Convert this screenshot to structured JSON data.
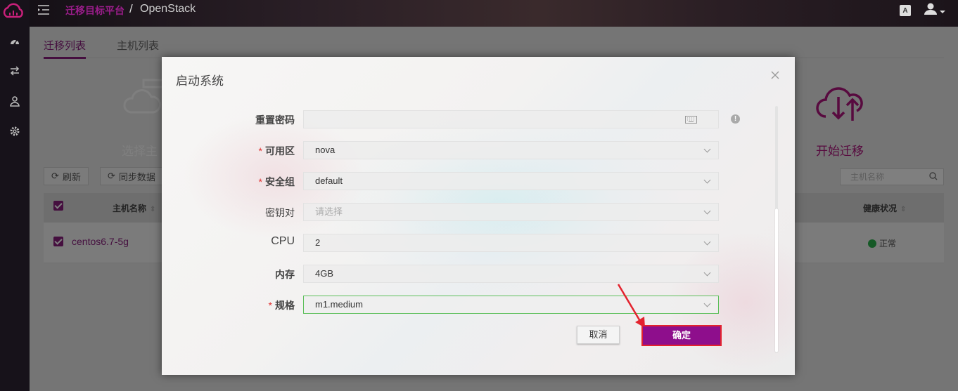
{
  "header": {
    "breadcrumb_home": "迁移目标平台",
    "breadcrumb_separator": "/",
    "breadcrumb_current": "OpenStack",
    "lang_badge": "A"
  },
  "icons": {
    "logo": "cloud-logo-icon",
    "rail": [
      "dashboard-icon",
      "transfer-icon",
      "user-icon",
      "settings-icon"
    ],
    "menu": "menu-toggle-icon",
    "user": "user-avatar-icon"
  },
  "page": {
    "tabs": [
      {
        "label": "迁移列表",
        "active": true
      },
      {
        "label": "主机列表",
        "active": false
      }
    ],
    "steps": [
      {
        "label": "选择主",
        "icon": "cloud-server-icon"
      },
      {
        "label": "开始迁移",
        "icon": "cloud-transfer-icon"
      }
    ],
    "toolbar": {
      "refresh": "刷新",
      "sync": "同步数据"
    },
    "search_placeholder": "主机名称",
    "table": {
      "col_host": "主机名称",
      "col_health": "健康状况",
      "rows": [
        {
          "host": "centos6.7-5g",
          "health": "正常"
        }
      ]
    }
  },
  "modal": {
    "title": "启动系统",
    "fields": [
      {
        "label": "重置密码",
        "required": false,
        "value": "",
        "placeholder": "",
        "kind": "password"
      },
      {
        "label": "可用区",
        "required": true,
        "value": "nova",
        "placeholder": "",
        "kind": "select"
      },
      {
        "label": "安全组",
        "required": true,
        "value": "default",
        "placeholder": "",
        "kind": "select"
      },
      {
        "label": "密钥对",
        "required": false,
        "value": "",
        "placeholder": "请选择",
        "kind": "select"
      },
      {
        "label": "CPU",
        "required": false,
        "value": "2",
        "placeholder": "",
        "kind": "select"
      },
      {
        "label": "内存",
        "required": false,
        "value": "4GB",
        "placeholder": "",
        "kind": "select"
      },
      {
        "label": "规格",
        "required": true,
        "value": "m1.medium",
        "placeholder": "",
        "kind": "select"
      }
    ],
    "required_mark": "*",
    "info_mark": "!",
    "cancel_label": "取消",
    "confirm_label": "确定"
  },
  "colors": {
    "brand": "#8a1f7e",
    "confirm_button": "#8e0e8c",
    "highlight_border": "#e3232e",
    "focus_border": "#5cbf5a",
    "health_ok": "#2bb24c"
  }
}
